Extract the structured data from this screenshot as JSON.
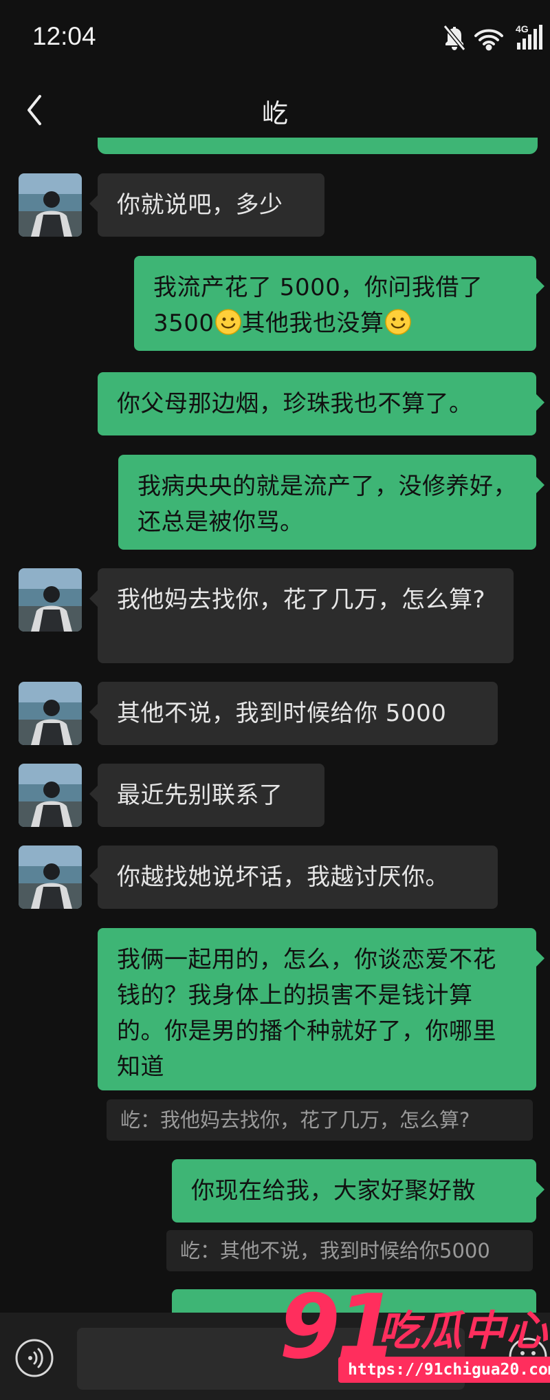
{
  "status_bar": {
    "time": "12:04",
    "network_label": "4G"
  },
  "header": {
    "title": "屹"
  },
  "messages": [
    {
      "side": "in",
      "text": "你就说吧，多少"
    },
    {
      "side": "out",
      "text_a": "我流产花了 5000，你问我借了 3500",
      "text_b": "其他我也没算",
      "emoji": "smile-emoji"
    },
    {
      "side": "out",
      "text": "你父母那边烟，珍珠我也不算了。"
    },
    {
      "side": "out",
      "text": "我病央央的就是流产了，没修养好，还总是被你骂。"
    },
    {
      "side": "in",
      "text": "我他妈去找你，花了几万，怎么算?"
    },
    {
      "side": "in",
      "text": "其他不说，我到时候给你 5000"
    },
    {
      "side": "in",
      "text": "最近先别联系了"
    },
    {
      "side": "in",
      "text": "你越找她说坏话，我越讨厌你。"
    },
    {
      "side": "out",
      "text": "我俩一起用的，怎么，你谈恋爱不花钱的？我身体上的损害不是钱计算的。你是男的播个种就好了，你哪里知道",
      "quote": "屹：我他妈去找你，花了几万，怎么算?"
    },
    {
      "side": "out",
      "text": "你现在给我，大家好聚好散",
      "quote": "屹：其他不说，我到时候给你5000"
    }
  ],
  "watermark": {
    "number": "91",
    "text": "吃瓜中心",
    "url": "https://91chigua20.com"
  },
  "colors": {
    "outgoing_bubble": "#3eb575",
    "incoming_bubble": "#2c2c2c",
    "background": "#111111",
    "watermark": "#ff2e5d"
  }
}
